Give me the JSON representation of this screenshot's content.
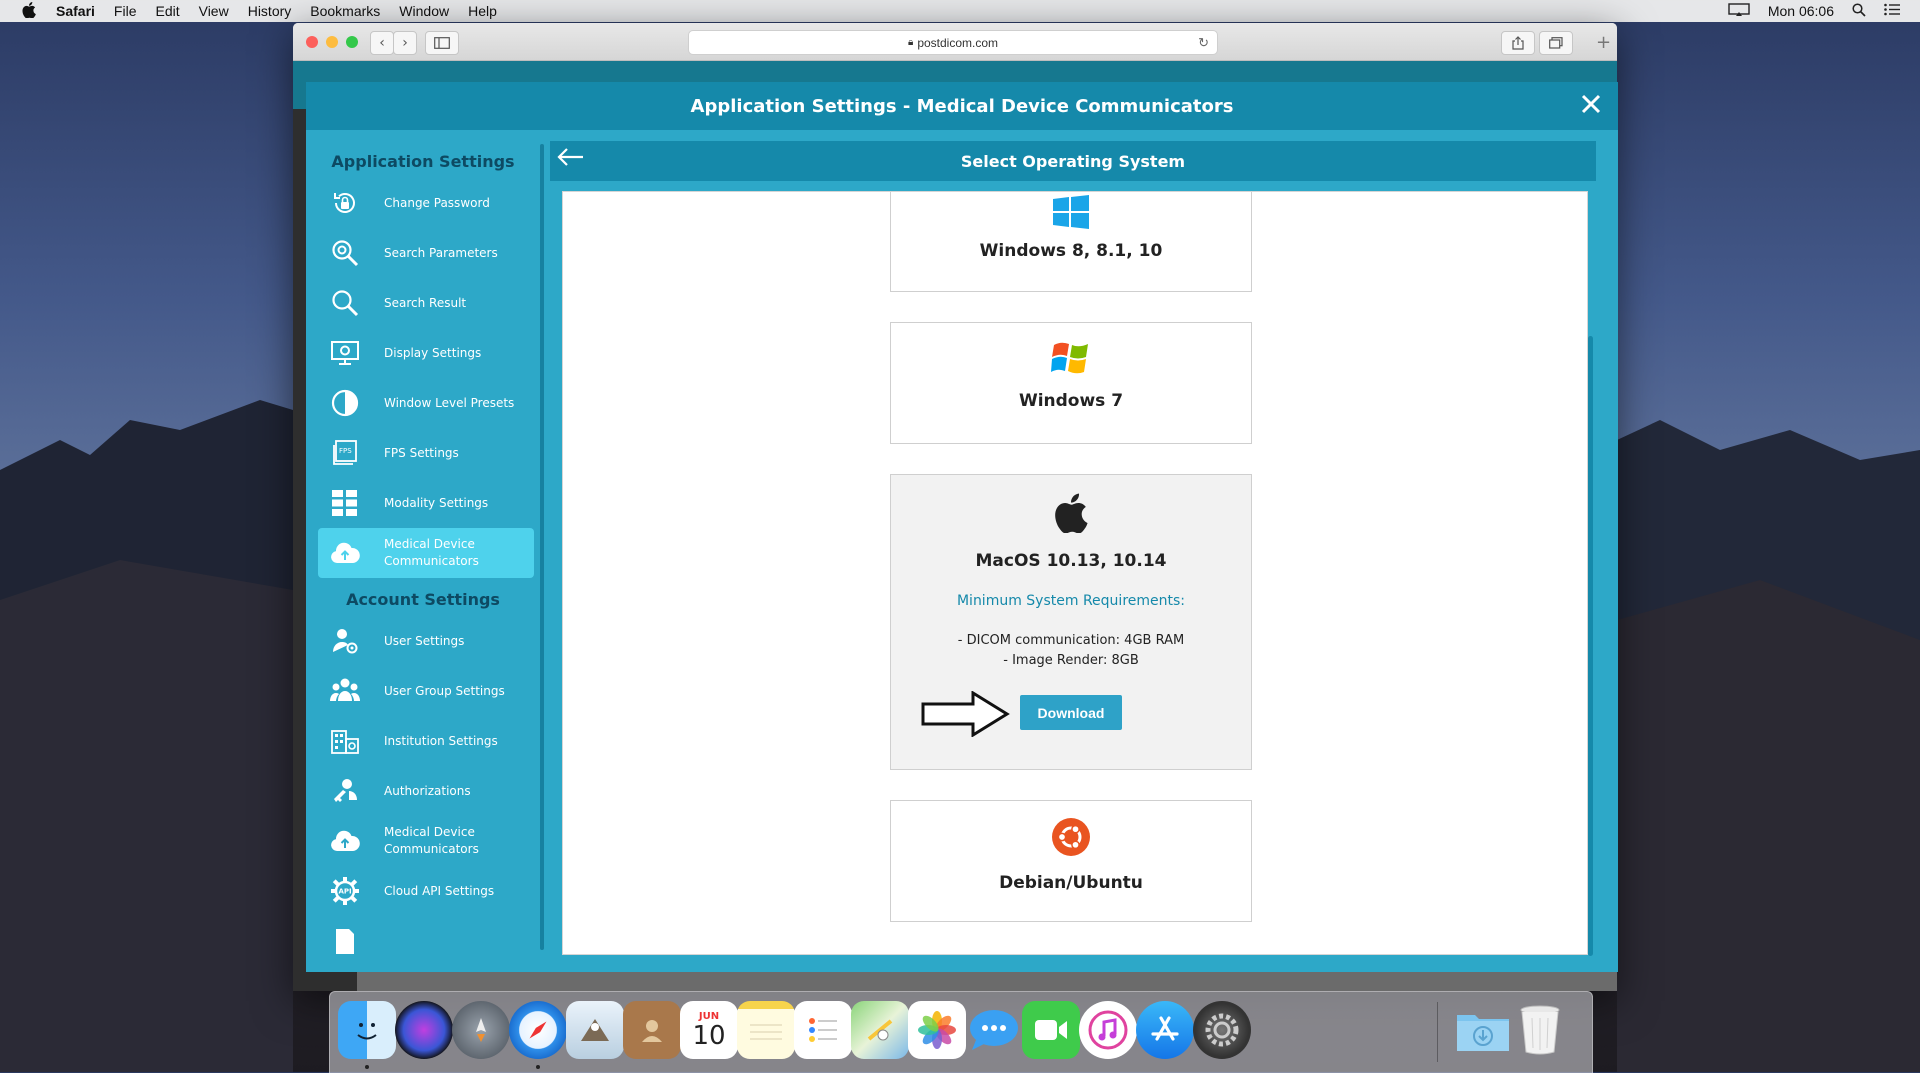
{
  "menubar": {
    "items": [
      "Safari",
      "File",
      "Edit",
      "View",
      "History",
      "Bookmarks",
      "Window",
      "Help"
    ],
    "clock": "Mon 06:06"
  },
  "browser": {
    "url": "postdicom.com"
  },
  "modal": {
    "title": "Application Settings - Medical Device Communicators"
  },
  "sidebar": {
    "app_settings_title": "Application Settings",
    "app_items": [
      {
        "label": "Change Password",
        "icon": "lock-refresh-icon"
      },
      {
        "label": "Search Parameters",
        "icon": "search-gear-icon"
      },
      {
        "label": "Search Result",
        "icon": "search-icon"
      },
      {
        "label": "Display Settings",
        "icon": "monitor-gear-icon"
      },
      {
        "label": "Window Level Presets",
        "icon": "contrast-icon"
      },
      {
        "label": "FPS Settings",
        "icon": "fps-icon"
      },
      {
        "label": "Modality Settings",
        "icon": "grid-icon"
      },
      {
        "label": "Medical Device Communicators",
        "icon": "cloud-upload-icon"
      }
    ],
    "account_settings_title": "Account Settings",
    "account_items": [
      {
        "label": "User Settings",
        "icon": "user-gear-icon"
      },
      {
        "label": "User Group Settings",
        "icon": "user-group-icon"
      },
      {
        "label": "Institution Settings",
        "icon": "institution-icon"
      },
      {
        "label": "Authorizations",
        "icon": "key-user-icon"
      },
      {
        "label": "Medical Device Communicators",
        "icon": "cloud-upload-icon"
      },
      {
        "label": "Cloud API Settings",
        "icon": "api-gear-icon"
      }
    ]
  },
  "content": {
    "title": "Select Operating System",
    "os_options": [
      {
        "name": "Windows 8, 8.1, 10",
        "icon": "windows-10-logo-icon"
      },
      {
        "name": "Windows 7",
        "icon": "windows-7-logo-icon"
      },
      {
        "name": "MacOS 10.13, 10.14",
        "icon": "apple-logo-icon",
        "requirements_title": "Minimum System Requirements:",
        "requirements": [
          "- DICOM communication: 4GB RAM",
          "- Image Render: 8GB"
        ],
        "download_label": "Download"
      },
      {
        "name": "Debian/Ubuntu",
        "icon": "ubuntu-logo-icon"
      }
    ]
  },
  "dock": {
    "calendar_month": "JUN",
    "calendar_day": "10",
    "apps": [
      "Finder",
      "Siri",
      "Launchpad",
      "Safari",
      "Mail",
      "Contacts",
      "Calendar",
      "Notes",
      "Reminders",
      "Maps",
      "Photos",
      "Messages",
      "FaceTime",
      "iTunes",
      "App Store",
      "System Preferences",
      "Downloads",
      "Trash"
    ]
  },
  "colors": {
    "modal_header": "#1589aa",
    "modal_body": "#2da8c8",
    "active_item": "#4ed2ec",
    "download_button": "#2ea2c8"
  }
}
